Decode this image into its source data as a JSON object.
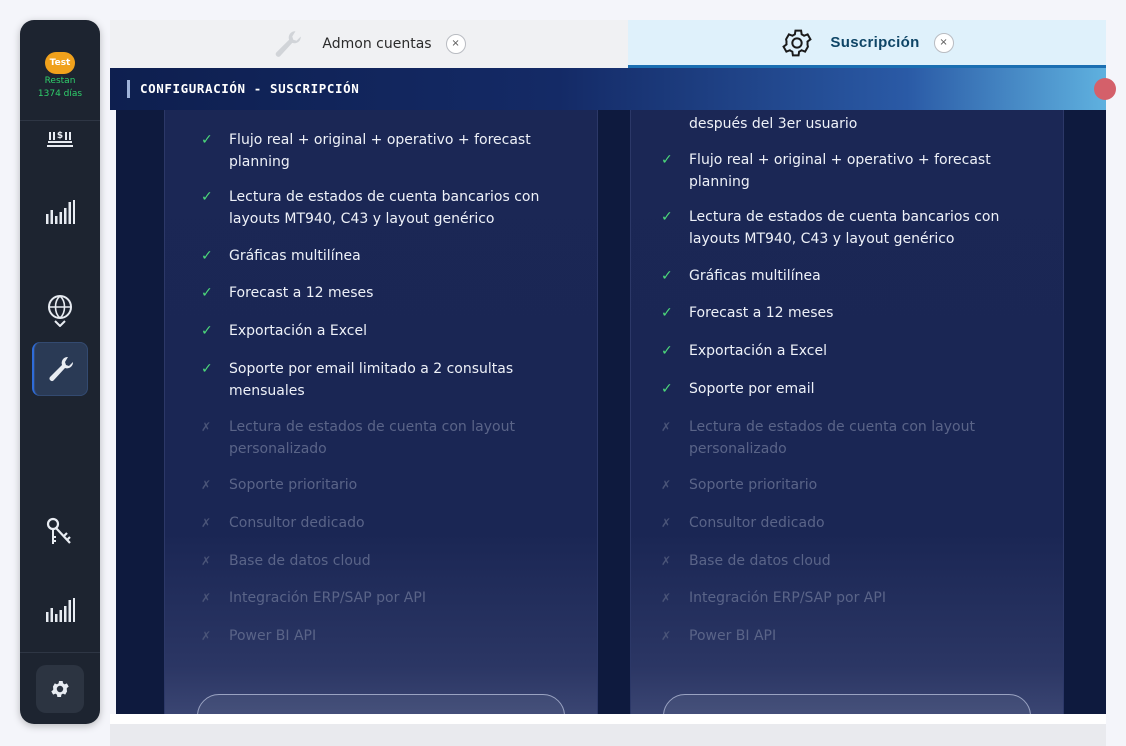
{
  "sidebar": {
    "badge": "Test",
    "remaining_line1": "Restan",
    "remaining_line2": "1374 días",
    "icons": [
      "bank-icon",
      "bar-chart-icon",
      "globe-icon",
      "wrench-icon",
      "keys-icon",
      "bar-chart-icon",
      "gear-icon"
    ],
    "active_icon": "wrench-icon"
  },
  "tabs": [
    {
      "label": "Admon cuentas",
      "icon": "wrench-icon",
      "close": "×",
      "active": false
    },
    {
      "label": "Suscripción",
      "icon": "gear-icon",
      "close": "×",
      "active": true
    }
  ],
  "header": {
    "title": "CONFIGURACIÓN - SUSCRIPCIÓN"
  },
  "plans": [
    {
      "features": [
        {
          "text": "Flujo real + original + operativo + forecast planning",
          "included": true,
          "mark": "✓"
        },
        {
          "text": "Lectura de estados de cuenta bancarios con layouts MT940, C43 y layout genérico",
          "included": true,
          "mark": "✓"
        },
        {
          "text": "Gráficas multilínea",
          "included": true,
          "mark": "✓"
        },
        {
          "text": "Forecast a 12 meses",
          "included": true,
          "mark": "✓"
        },
        {
          "text": "Exportación a Excel",
          "included": true,
          "mark": "✓"
        },
        {
          "text": "Soporte por email limitado a 2 consultas mensuales",
          "included": true,
          "mark": "✓"
        },
        {
          "text": "Lectura de estados de cuenta con layout personalizado",
          "included": false,
          "mark": "✗"
        },
        {
          "text": "Soporte prioritario",
          "included": false,
          "mark": "✗"
        },
        {
          "text": "Consultor dedicado",
          "included": false,
          "mark": "✗"
        },
        {
          "text": "Base de datos cloud",
          "included": false,
          "mark": "✗"
        },
        {
          "text": "Integración ERP/SAP por API",
          "included": false,
          "mark": "✗"
        },
        {
          "text": "Power BI API",
          "included": false,
          "mark": "✗"
        }
      ]
    },
    {
      "top_partial": "después del 3er usuario",
      "features": [
        {
          "text": "Flujo real + original + operativo + forecast planning",
          "included": true,
          "mark": "✓"
        },
        {
          "text": "Lectura de estados de cuenta bancarios con layouts MT940, C43 y layout genérico",
          "included": true,
          "mark": "✓"
        },
        {
          "text": "Gráficas multilínea",
          "included": true,
          "mark": "✓"
        },
        {
          "text": "Forecast a 12 meses",
          "included": true,
          "mark": "✓"
        },
        {
          "text": "Exportación a Excel",
          "included": true,
          "mark": "✓"
        },
        {
          "text": "Soporte por email",
          "included": true,
          "mark": "✓"
        },
        {
          "text": "Lectura de estados de cuenta con layout personalizado",
          "included": false,
          "mark": "✗"
        },
        {
          "text": "Soporte prioritario",
          "included": false,
          "mark": "✗"
        },
        {
          "text": "Consultor dedicado",
          "included": false,
          "mark": "✗"
        },
        {
          "text": "Base de datos cloud",
          "included": false,
          "mark": "✗"
        },
        {
          "text": "Integración ERP/SAP por API",
          "included": false,
          "mark": "✗"
        },
        {
          "text": "Power BI API",
          "included": false,
          "mark": "✗"
        }
      ]
    }
  ],
  "colors": {
    "accent": "#1b6fb2",
    "check": "#4cd97a",
    "badge": "#f0a11c",
    "remaining": "#2fcf6b"
  }
}
